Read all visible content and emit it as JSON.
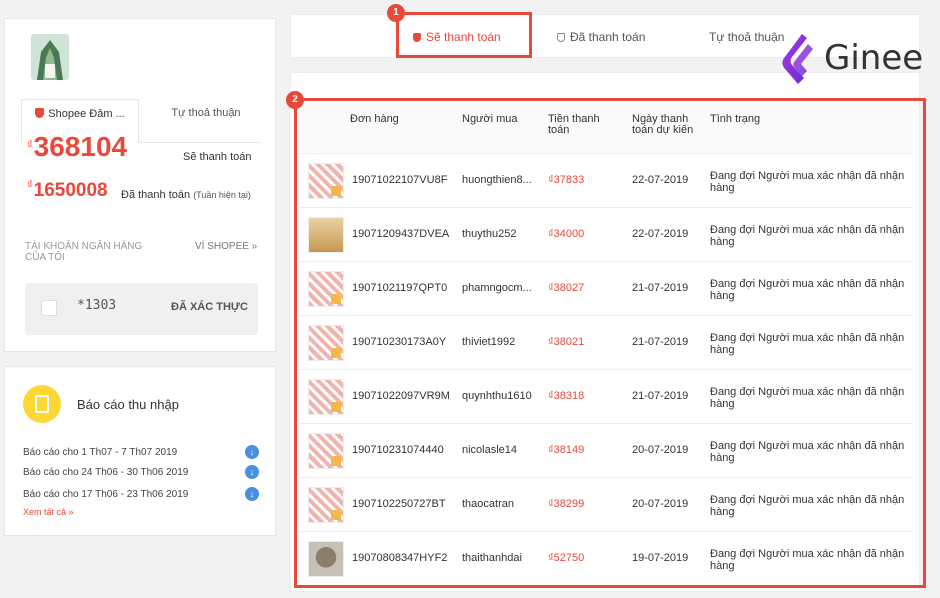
{
  "account": {
    "tabs": [
      "Shopee Đảm ...",
      "Tự thoả thuận"
    ],
    "pending_amount": "368104",
    "pending_label": "Sẽ thanh toán",
    "paid_amount": "1650008",
    "paid_label": "Đã thanh toán",
    "paid_note": "(Tuần hiện tại)",
    "currency": "₫",
    "bank_label": "TÀI KHOẢN NGÂN HÀNG CỦA TÔI",
    "wallet_link": "VÍ SHOPEE »",
    "bank_account": "*1303",
    "bank_status": "ĐÃ XÁC THỰC"
  },
  "report": {
    "title": "Báo cáo thu nhập",
    "items": [
      "Báo cáo cho 1 Th07 - 7 Th07 2019",
      "Báo cáo cho 24 Th06 - 30 Th06 2019",
      "Báo cáo cho 17 Th06 - 23 Th06 2019"
    ],
    "see_all": "Xem tất cả »"
  },
  "top_tabs": [
    "Sẽ thanh toán",
    "Đã thanh toán",
    "Tự thoả thuận"
  ],
  "badges": [
    "1",
    "2"
  ],
  "logo_text": "Ginee",
  "table": {
    "headers": [
      "Đơn hàng",
      "Người mua",
      "Tiền thanh toán",
      "Ngày thanh toán dự kiến",
      "Tình trạng"
    ],
    "rows": [
      {
        "order": "19071022107VU8F",
        "buyer": "huongthien8...",
        "amount": "₫37833",
        "date": "22-07-2019",
        "status": "Đang đợi Người mua xác nhận đã nhận hàng",
        "thumb": "red"
      },
      {
        "order": "19071209437DVEA",
        "buyer": "thuythu252",
        "amount": "₫34000",
        "date": "22-07-2019",
        "status": "Đang đợi Người mua xác nhận đã nhận hàng",
        "thumb": "wood"
      },
      {
        "order": "19071021197QPT0",
        "buyer": "phamngocm...",
        "amount": "₫38027",
        "date": "21-07-2019",
        "status": "Đang đợi Người mua xác nhận đã nhận hàng",
        "thumb": "red"
      },
      {
        "order": "190710230173A0Y",
        "buyer": "thiviet1992",
        "amount": "₫38021",
        "date": "21-07-2019",
        "status": "Đang đợi Người mua xác nhận đã nhận hàng",
        "thumb": "red"
      },
      {
        "order": "19071022097VR9M",
        "buyer": "quynhthu1610",
        "amount": "₫38318",
        "date": "21-07-2019",
        "status": "Đang đợi Người mua xác nhận đã nhận hàng",
        "thumb": "red"
      },
      {
        "order": "190710231074440",
        "buyer": "nicolasle14",
        "amount": "₫38149",
        "date": "20-07-2019",
        "status": "Đang đợi Người mua xác nhận đã nhận hàng",
        "thumb": "red"
      },
      {
        "order": "1907102250727BT",
        "buyer": "thaocatran",
        "amount": "₫38299",
        "date": "20-07-2019",
        "status": "Đang đợi Người mua xác nhận đã nhận hàng",
        "thumb": "red"
      },
      {
        "order": "19070808347HYF2",
        "buyer": "thaithanhdai",
        "amount": "₫52750",
        "date": "19-07-2019",
        "status": "Đang đợi Người mua xác nhận đã nhận hàng",
        "thumb": "owl"
      }
    ]
  }
}
